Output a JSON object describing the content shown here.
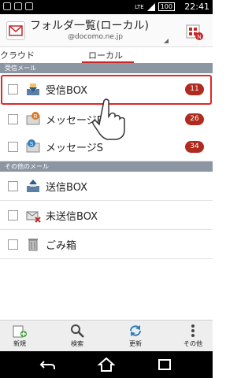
{
  "status_bar": {
    "time": "22:41",
    "battery": "100",
    "network": "LTE"
  },
  "header": {
    "title": "フォルダ一覧(ローカル)",
    "account": "@docomo.ne.jp"
  },
  "tabs": {
    "cloud": "クラウド",
    "local": "ローカル"
  },
  "sections": {
    "received": "受信メール",
    "other": "その他のメール"
  },
  "folders_received": [
    {
      "label": "受信BOX",
      "count": "11"
    },
    {
      "label": "メッセージR",
      "count": "26"
    },
    {
      "label": "メッセージS",
      "count": "34"
    }
  ],
  "folders_other": [
    {
      "label": "送信BOX"
    },
    {
      "label": "未送信BOX"
    },
    {
      "label": "ごみ箱"
    }
  ],
  "toolbar": {
    "new": "新規",
    "search": "検索",
    "refresh": "更新",
    "more": "その他"
  },
  "colors": {
    "accent": "#c62828",
    "badge": "#b02a1e",
    "section_bg": "#8c96a3"
  }
}
